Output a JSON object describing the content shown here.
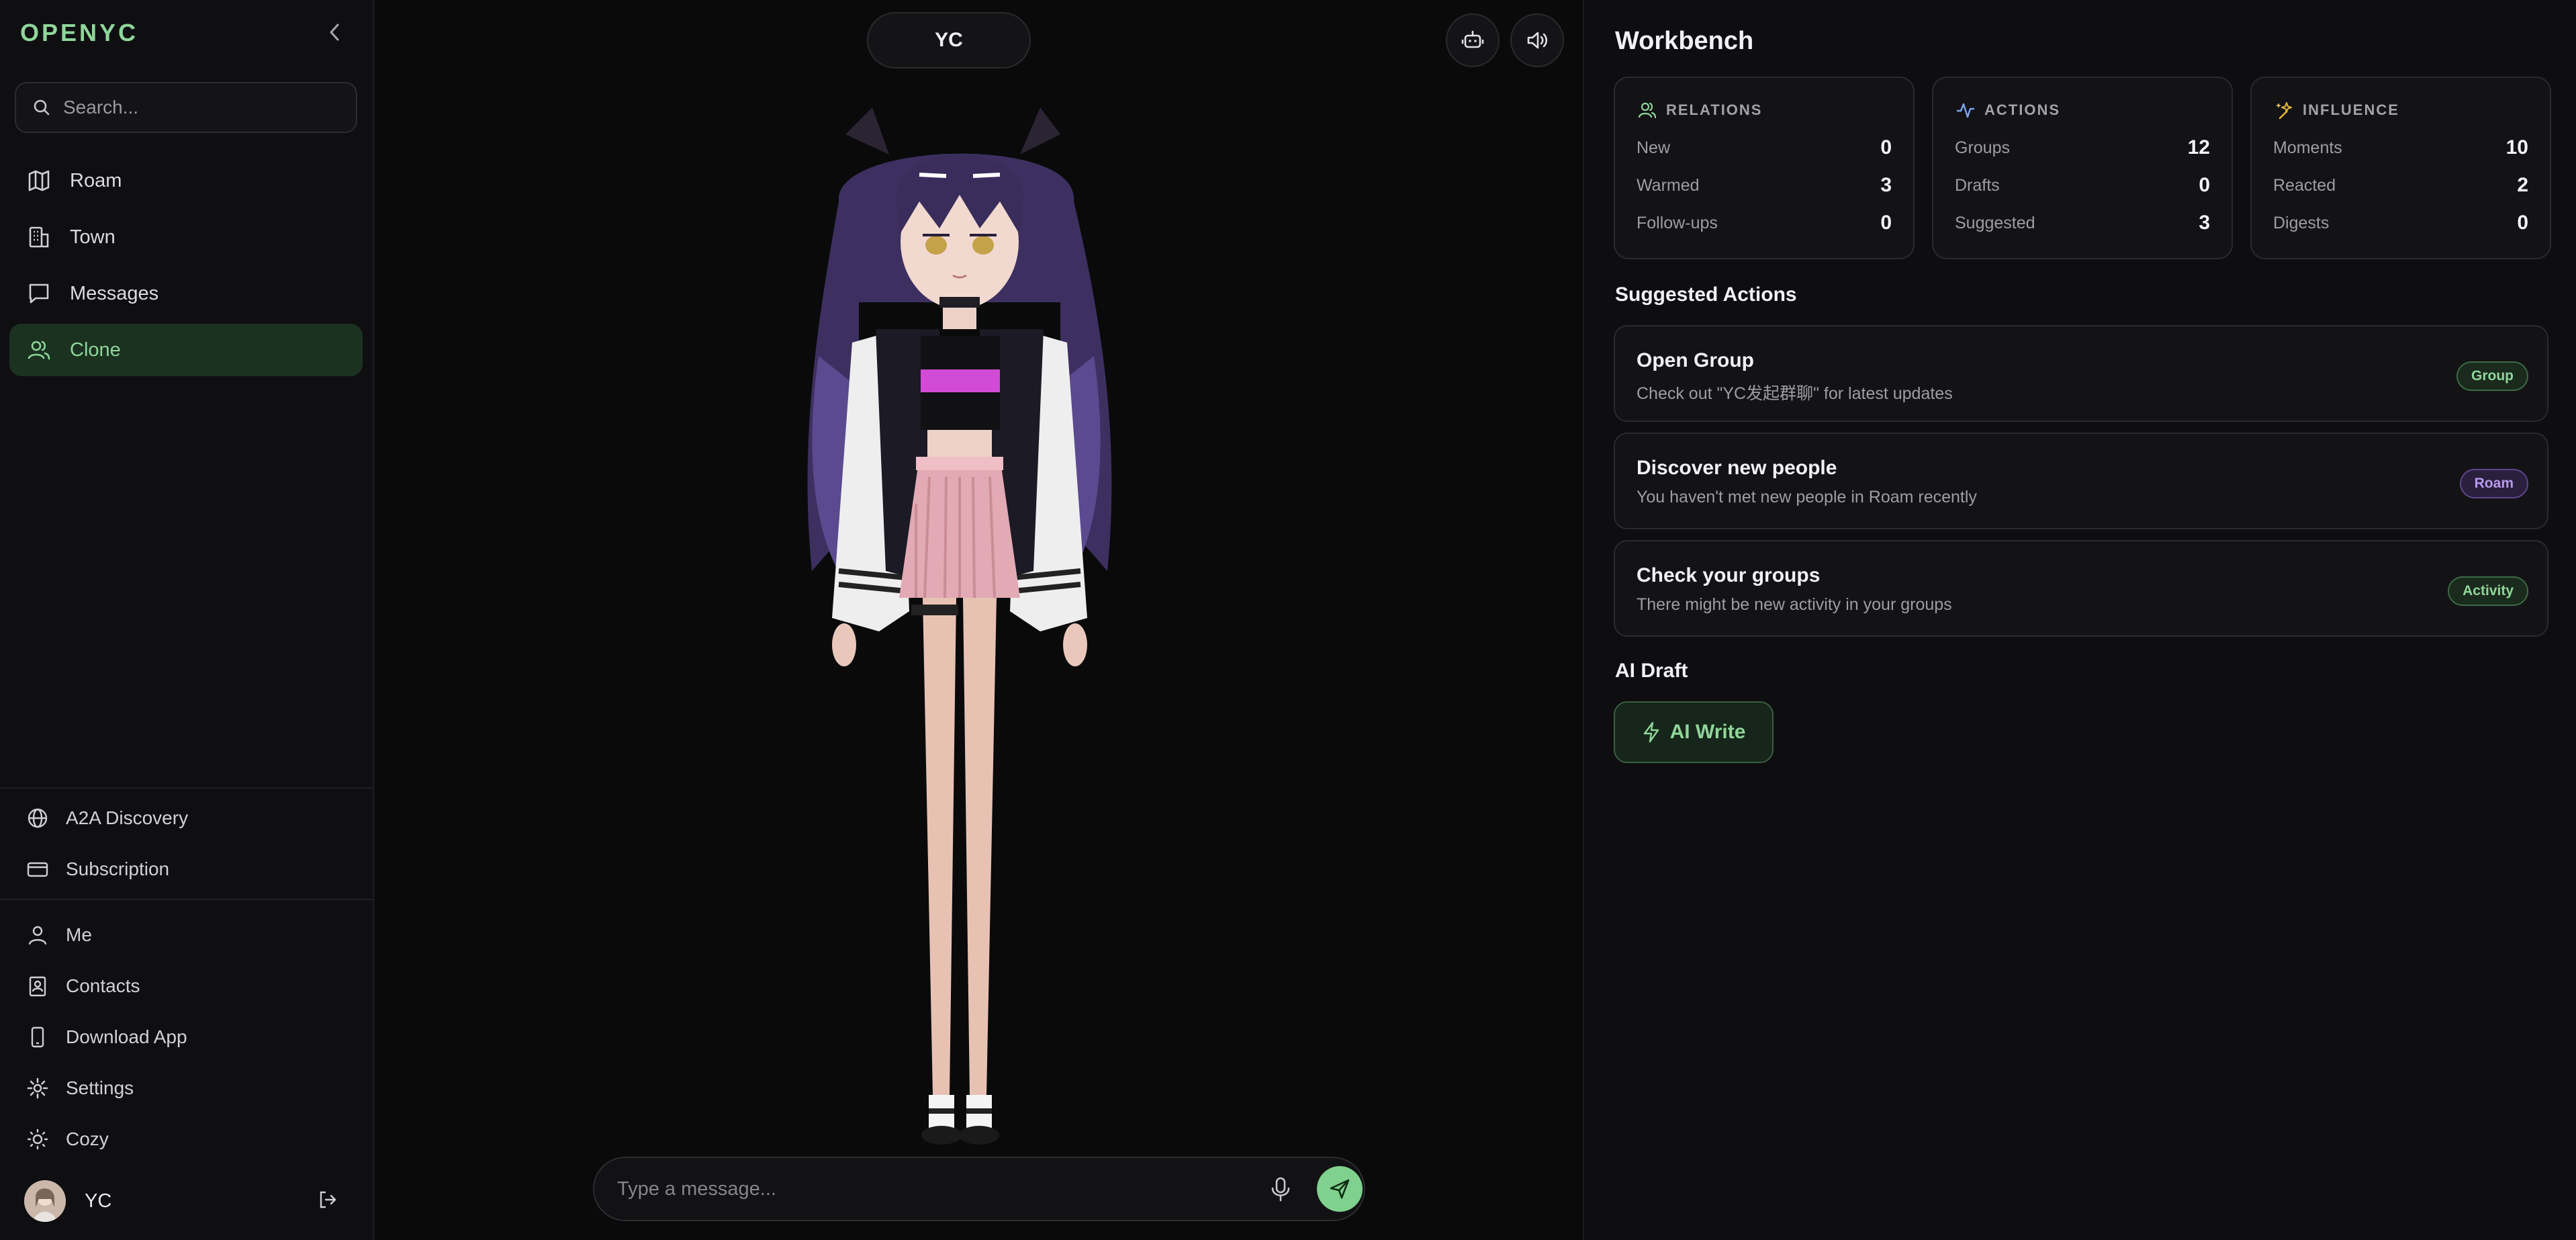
{
  "app": {
    "brand": "OPENYC"
  },
  "search": {
    "placeholder": "Search..."
  },
  "nav": {
    "items": [
      {
        "label": "Roam",
        "icon": "map-icon"
      },
      {
        "label": "Town",
        "icon": "building-icon"
      },
      {
        "label": "Messages",
        "icon": "message-icon"
      },
      {
        "label": "Clone",
        "icon": "users-icon",
        "active": true
      }
    ]
  },
  "secondary": {
    "discovery": "A2A Discovery",
    "subscription": "Subscription"
  },
  "account": {
    "me": "Me",
    "contacts": "Contacts",
    "download": "Download App",
    "settings": "Settings",
    "theme": "Cozy"
  },
  "user": {
    "name": "YC"
  },
  "stage": {
    "name": "YC",
    "message_placeholder": "Type a message..."
  },
  "workbench": {
    "title": "Workbench",
    "relations": {
      "header": "RELATIONS",
      "rows": [
        {
          "label": "New",
          "value": "0"
        },
        {
          "label": "Warmed",
          "value": "3"
        },
        {
          "label": "Follow-ups",
          "value": "0"
        }
      ]
    },
    "actions": {
      "header": "ACTIONS",
      "rows": [
        {
          "label": "Groups",
          "value": "12"
        },
        {
          "label": "Drafts",
          "value": "0"
        },
        {
          "label": "Suggested",
          "value": "3"
        }
      ]
    },
    "influence": {
      "header": "INFLUENCE",
      "rows": [
        {
          "label": "Moments",
          "value": "10"
        },
        {
          "label": "Reacted",
          "value": "2"
        },
        {
          "label": "Digests",
          "value": "0"
        }
      ]
    },
    "suggested_title": "Suggested Actions",
    "suggested": [
      {
        "title": "Open Group",
        "desc": "Check out \"YC发起群聊\" for latest updates",
        "tag": "Group"
      },
      {
        "title": "Discover new people",
        "desc": "You haven't met new people in Roam recently",
        "tag": "Roam"
      },
      {
        "title": "Check your groups",
        "desc": "There might be new activity in your groups",
        "tag": "Activity"
      }
    ],
    "ai_draft_title": "AI Draft",
    "ai_write": "AI Write"
  },
  "colors": {
    "accent": "#8fd69a",
    "active_bg": "#1c3221",
    "tag_purple": "#b89af0",
    "send": "#7fd18d"
  }
}
